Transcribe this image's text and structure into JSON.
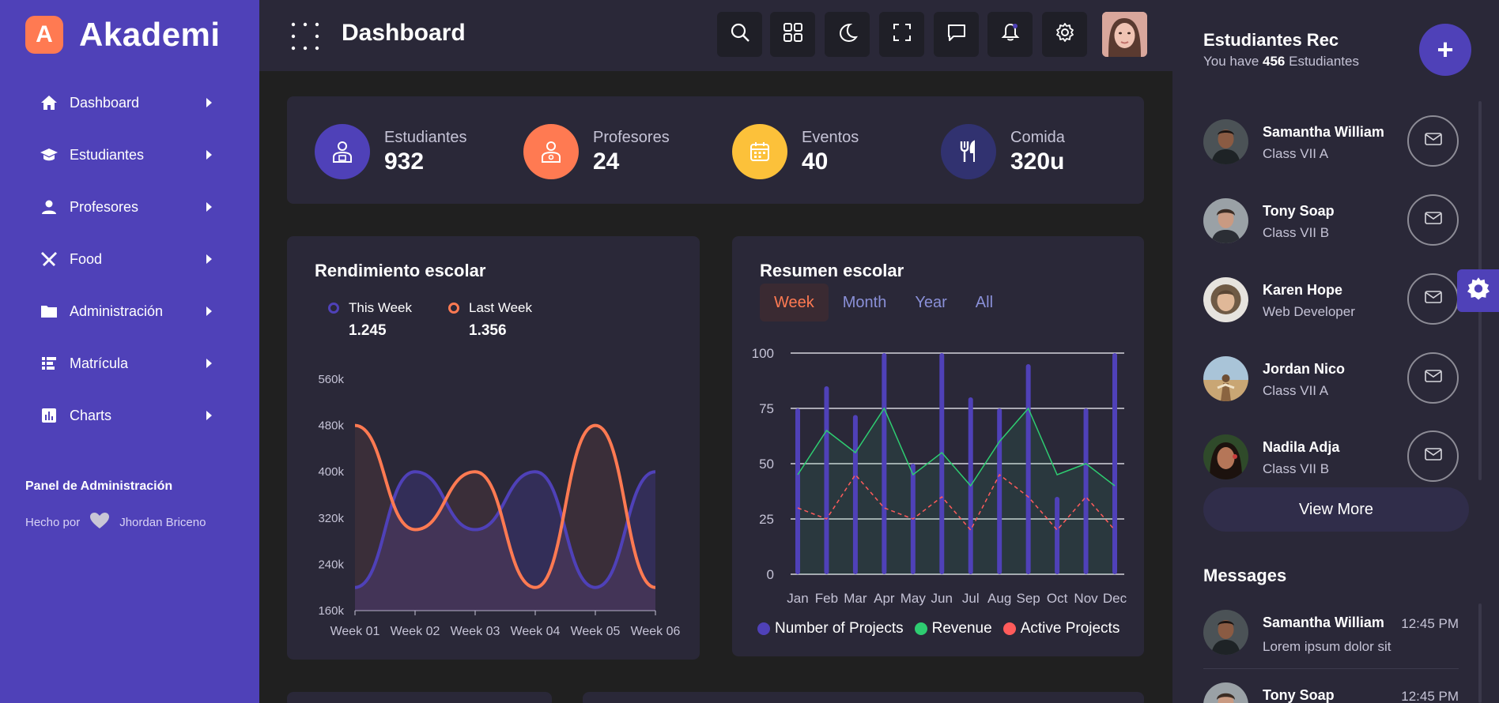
{
  "brand": {
    "logo_letter": "A",
    "name": "Akademi"
  },
  "sidebar": {
    "items": [
      {
        "label": "Dashboard",
        "icon": "home-icon"
      },
      {
        "label": "Estudiantes",
        "icon": "graduation-cap-icon"
      },
      {
        "label": "Profesores",
        "icon": "user-icon"
      },
      {
        "label": "Food",
        "icon": "utensils-icon"
      },
      {
        "label": "Administración",
        "icon": "folder-icon"
      },
      {
        "label": "Matrícula",
        "icon": "enrollment-icon"
      },
      {
        "label": "Charts",
        "icon": "bar-chart-icon"
      }
    ],
    "panel_title": "Panel de Administración",
    "made_by_prefix": "Hecho por",
    "made_by_author": "Jhordan Briceno"
  },
  "header": {
    "title": "Dashboard"
  },
  "stats": [
    {
      "label": "Estudiantes",
      "value": "932",
      "color": "#4f41b8",
      "icon": "student-icon"
    },
    {
      "label": "Profesores",
      "value": "24",
      "color": "#ff7a52",
      "icon": "teacher-icon"
    },
    {
      "label": "Eventos",
      "value": "40",
      "color": "#fcc13a",
      "icon": "calendar-icon"
    },
    {
      "label": "Comida",
      "value": "320u",
      "color": "#313270",
      "icon": "utensils-icon"
    }
  ],
  "performance": {
    "title": "Rendimiento escolar",
    "legend": [
      {
        "label": "This Week",
        "value": "1.245",
        "color": "#4f41b8"
      },
      {
        "label": "Last Week",
        "value": "1.356",
        "color": "#ff7a52"
      }
    ]
  },
  "summary": {
    "title": "Resumen escolar",
    "tabs": [
      "Week",
      "Month",
      "Year",
      "All"
    ],
    "active_tab": "Week",
    "legend": [
      {
        "label": "Number of Projects",
        "color": "#4f41b8"
      },
      {
        "label": "Revenue",
        "color": "#2ecc71"
      },
      {
        "label": "Active Projects",
        "color": "#ff5b5b"
      }
    ]
  },
  "chart_data": [
    {
      "type": "line",
      "title": "Rendimiento escolar",
      "categories": [
        "Week 01",
        "Week 02",
        "Week 03",
        "Week 04",
        "Week 05",
        "Week 06"
      ],
      "yticks": [
        "160k",
        "240k",
        "320k",
        "400k",
        "480k",
        "560k"
      ],
      "ylim": [
        160,
        560
      ],
      "series": [
        {
          "name": "This Week",
          "color": "#4f41b8",
          "values": [
            200,
            400,
            300,
            400,
            200,
            400
          ]
        },
        {
          "name": "Last Week",
          "color": "#ff7a52",
          "values": [
            480,
            300,
            400,
            200,
            480,
            200
          ]
        }
      ]
    },
    {
      "type": "bar",
      "categories": [
        "Jan",
        "Feb",
        "Mar",
        "Apr",
        "May",
        "Jun",
        "Jul",
        "Aug",
        "Sep",
        "Oct",
        "Nov",
        "Dec"
      ],
      "yticks": [
        "0",
        "25",
        "50",
        "75",
        "100"
      ],
      "ylim": [
        0,
        100
      ],
      "series": [
        {
          "name": "Number of Projects",
          "color": "#4f41b8",
          "values": [
            75,
            85,
            72,
            100,
            50,
            100,
            80,
            75,
            95,
            35,
            75,
            100
          ]
        },
        {
          "name": "Revenue",
          "color": "#2ecc71",
          "values": [
            45,
            65,
            55,
            75,
            45,
            55,
            40,
            60,
            75,
            45,
            50,
            40
          ]
        },
        {
          "name": "Active Projects",
          "color": "#ff5b5b",
          "values": [
            30,
            25,
            45,
            30,
            25,
            35,
            20,
            45,
            35,
            20,
            35,
            20
          ]
        }
      ]
    }
  ],
  "students_panel": {
    "title": "Estudiantes Rec",
    "subtitle_prefix": "You have",
    "count": "456",
    "subtitle_suffix": "Estudiantes",
    "add_label": "+",
    "students": [
      {
        "name": "Samantha William",
        "class": "Class VII A"
      },
      {
        "name": "Tony Soap",
        "class": "Class VII B"
      },
      {
        "name": "Karen Hope",
        "class": "Web Developer"
      },
      {
        "name": "Jordan Nico",
        "class": "Class VII A"
      },
      {
        "name": "Nadila Adja",
        "class": "Class VII B"
      }
    ],
    "view_more": "View More"
  },
  "messages": {
    "title": "Messages",
    "items": [
      {
        "name": "Samantha William",
        "time": "12:45 PM",
        "text": "Lorem ipsum dolor sit"
      },
      {
        "name": "Tony Soap",
        "time": "12:45 PM",
        "text": ""
      }
    ]
  }
}
